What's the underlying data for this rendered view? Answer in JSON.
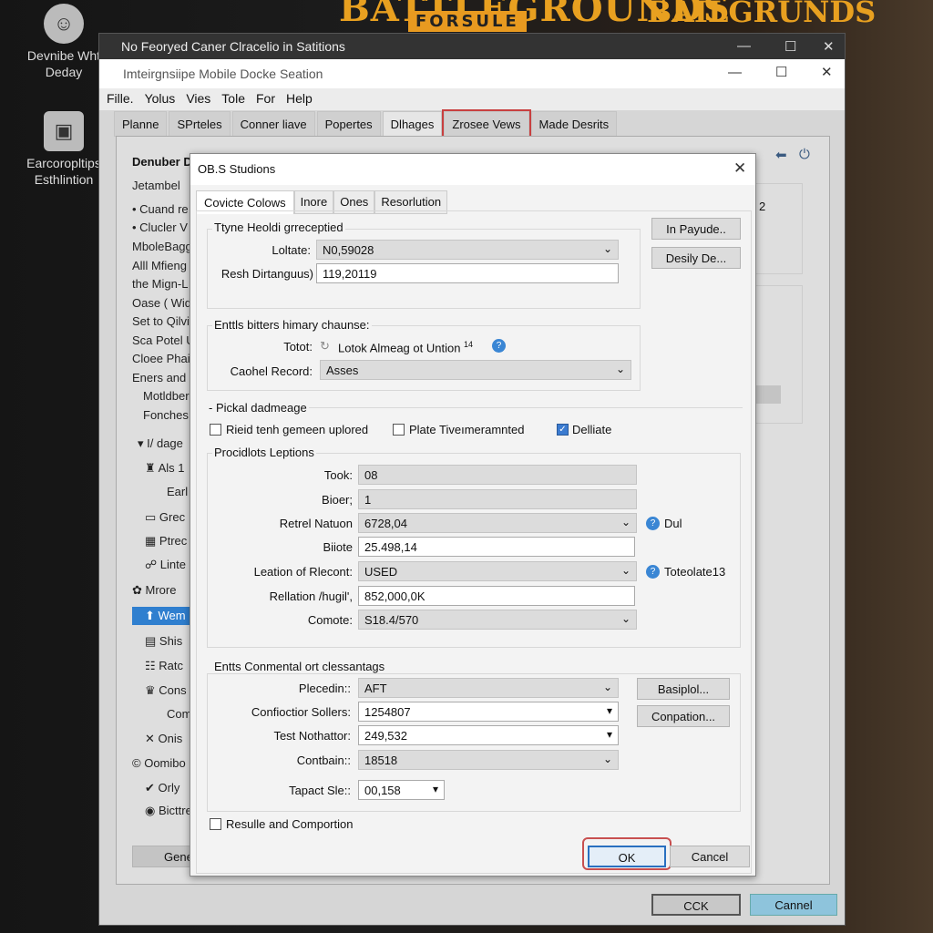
{
  "desktop": {
    "icons": [
      {
        "label": "Devnibe Wht Deday",
        "icon": "user-badge-icon"
      },
      {
        "label": "Earcoropltips Esthlintion",
        "icon": "folder-icon"
      }
    ],
    "logos": {
      "main": "BATTLEGROUNDS",
      "badge": "FORSULE",
      "right": "BAILGRUNDS"
    }
  },
  "outer_window": {
    "title": "No Feoryed Caner Clracelio in Satitions"
  },
  "app": {
    "title": "Imteirgnsiipe Mobile Docke Seation",
    "menu": [
      "Fille.",
      "Yolus",
      "Vies",
      "Tole",
      "For",
      "Help"
    ],
    "tabs": [
      {
        "label": "Planne"
      },
      {
        "label": "SPrteles"
      },
      {
        "label": "Conner liave"
      },
      {
        "label": "Popertes"
      },
      {
        "label": "Dlhages",
        "active": true
      },
      {
        "label": "Zrosee Vews",
        "highlighted": true
      },
      {
        "label": "Made Desrits"
      }
    ],
    "sidebar": {
      "heading": "Denuber D",
      "items": [
        "Jetambel",
        "• Cuand re",
        "• Clucler V",
        "MboleBagg",
        "Alll Mfieng",
        "the Mign-L",
        "Oase ( Wid",
        "Set to Qilvi",
        "Sca Potel U",
        "Cloee Phain",
        "Eners and I",
        "Motldber",
        "Fonches d",
        "▾ I/ dage",
        "Als 1",
        "Earl",
        "Grec",
        "Ptrec",
        "Linte",
        "Mrore",
        "Wem",
        "Shis",
        "Ratc",
        "Cons",
        "Com",
        "Onis",
        "Oomibo",
        "Orly",
        "Bicttre"
      ],
      "selected": "Wem",
      "bottom_button": "Gene"
    },
    "right_fragment": "2",
    "bottom_buttons": {
      "ok": "CCK",
      "cancel": "Cannel"
    },
    "accent": "#2f7fcf"
  },
  "dialog": {
    "title": "OB.S Studions",
    "tabs": [
      "Covicte Colows",
      "Inore",
      "Ones",
      "Resorlution"
    ],
    "group1": {
      "title": "Ttyne Heoldi grreceptied",
      "fields": [
        {
          "label": "Loltate:",
          "value": "N0,59028",
          "type": "select"
        },
        {
          "label": "Resh Dirtanguus)",
          "value": "119,20119",
          "type": "text"
        }
      ]
    },
    "side_buttons": [
      "In Payude..",
      "Desily De..."
    ],
    "group2": {
      "title": "Enttls bitters himary chaunse:",
      "total_label": "Totot:",
      "total_value": "Lotok Almeag ot Untion",
      "total_sup": "14",
      "record_label": "Caohel Record:",
      "record_value": "Asses"
    },
    "group3": {
      "title": "Pickal dadmeage",
      "checks": [
        {
          "label": "Rieid tenh gemeen uplored",
          "checked": false
        },
        {
          "label": "Plate Tiveımeramnted",
          "checked": false
        },
        {
          "label": "Delliate",
          "checked": true
        }
      ]
    },
    "group4": {
      "title": "Procidlots Leptions",
      "fields": [
        {
          "label": "Took:",
          "value": "08",
          "type": "readonly"
        },
        {
          "label": "Bioer;",
          "value": "1",
          "type": "readonly"
        },
        {
          "label": "Retrel Natuon",
          "value": "6728,04",
          "type": "select",
          "help": "Dul"
        },
        {
          "label": "Biiote",
          "value": "25.498,14",
          "type": "text"
        },
        {
          "label": "Leation of Rlecont:",
          "value": "USED",
          "type": "select",
          "help": "Toteolate13"
        },
        {
          "label": "Rellation /hugil',",
          "value": "852,000,0K",
          "type": "text"
        },
        {
          "label": "Comote:",
          "value": "S18.4/570",
          "type": "select"
        }
      ]
    },
    "group5": {
      "title": "Entts Conmental ort clessantags",
      "fields": [
        {
          "label": "Plecedin::",
          "value": "AFT",
          "type": "select"
        },
        {
          "label": "Confioctior Sollers:",
          "value": "1254807",
          "type": "combo"
        },
        {
          "label": "Test Nothattor:",
          "value": "249,532",
          "type": "combo"
        },
        {
          "label": "Contbain::",
          "value": "18518",
          "type": "select"
        },
        {
          "label": "Tapact Sle::",
          "value": "00,158",
          "type": "combo"
        }
      ],
      "buttons": [
        "Basiplol...",
        "Conpation..."
      ]
    },
    "bottom_check": {
      "label": "Resulle and Comportion",
      "checked": false
    },
    "ok": "OK",
    "cancel": "Cancel"
  }
}
